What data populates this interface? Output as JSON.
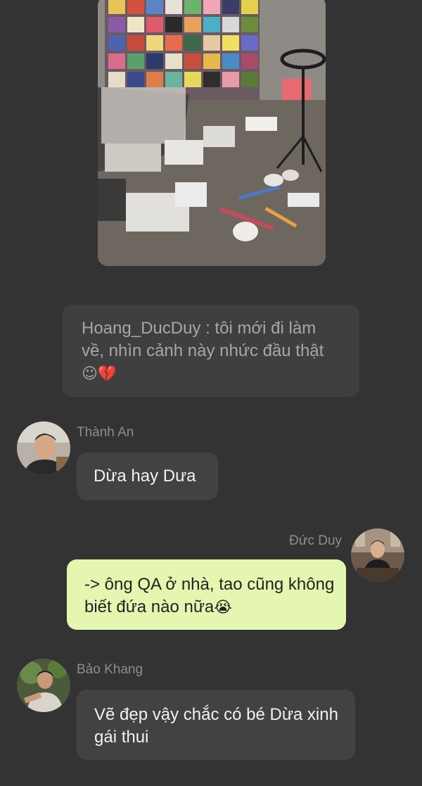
{
  "colors": {
    "background": "#333333",
    "bubble_incoming": "#424242",
    "bubble_outgoing": "#e4f6b0",
    "quote_background": "#3f3f3f",
    "sender_name": "#8d8d8d"
  },
  "shared_image": {
    "description_icon": "photo-of-art-studio-floor"
  },
  "quote": {
    "text": "Hoang_DucDuy : tôi mới đi làm về, nhìn cảnh này nhức đầu thật ",
    "emoji": "☺💔"
  },
  "messages": [
    {
      "sender": "Thành An",
      "text": "Dừa hay Dưa",
      "emoji": ""
    },
    {
      "sender": "Đức Duy",
      "text": "-> ông QA ở nhà, tao cũng không biết đứa nào nữa",
      "emoji": "😭"
    },
    {
      "sender": "Bảo Khang",
      "text": "Vẽ đẹp vậy chắc có bé Dừa xinh gái thui",
      "emoji": ""
    }
  ]
}
